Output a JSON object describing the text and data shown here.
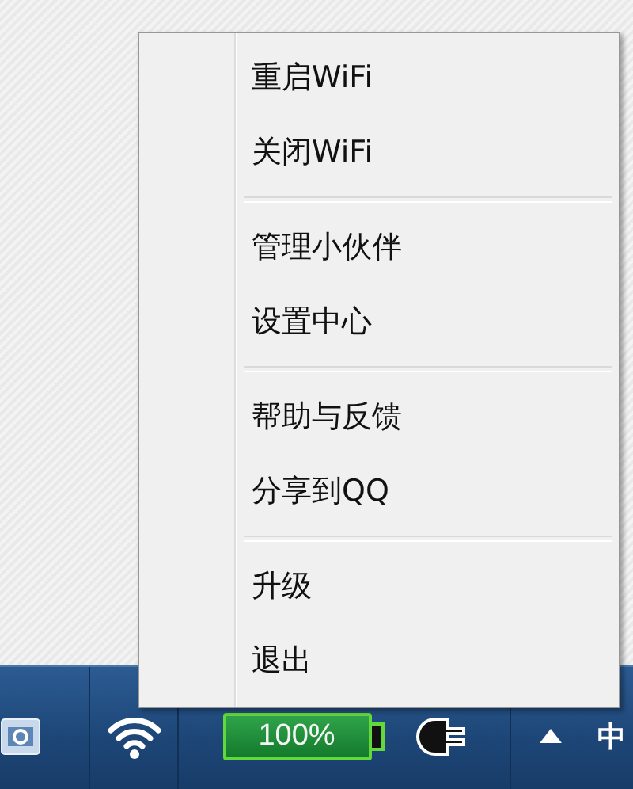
{
  "context_menu": {
    "sections": [
      {
        "items": [
          {
            "label": "重启WiFi"
          },
          {
            "label": "关闭WiFi"
          }
        ]
      },
      {
        "items": [
          {
            "label": "管理小伙伴"
          },
          {
            "label": "设置中心"
          }
        ]
      },
      {
        "items": [
          {
            "label": "帮助与反馈"
          },
          {
            "label": "分享到QQ"
          }
        ]
      },
      {
        "items": [
          {
            "label": "升级"
          },
          {
            "label": "退出"
          }
        ]
      }
    ]
  },
  "taskbar": {
    "battery": {
      "reading": "100%",
      "level": 1
    },
    "input_method": "中"
  }
}
